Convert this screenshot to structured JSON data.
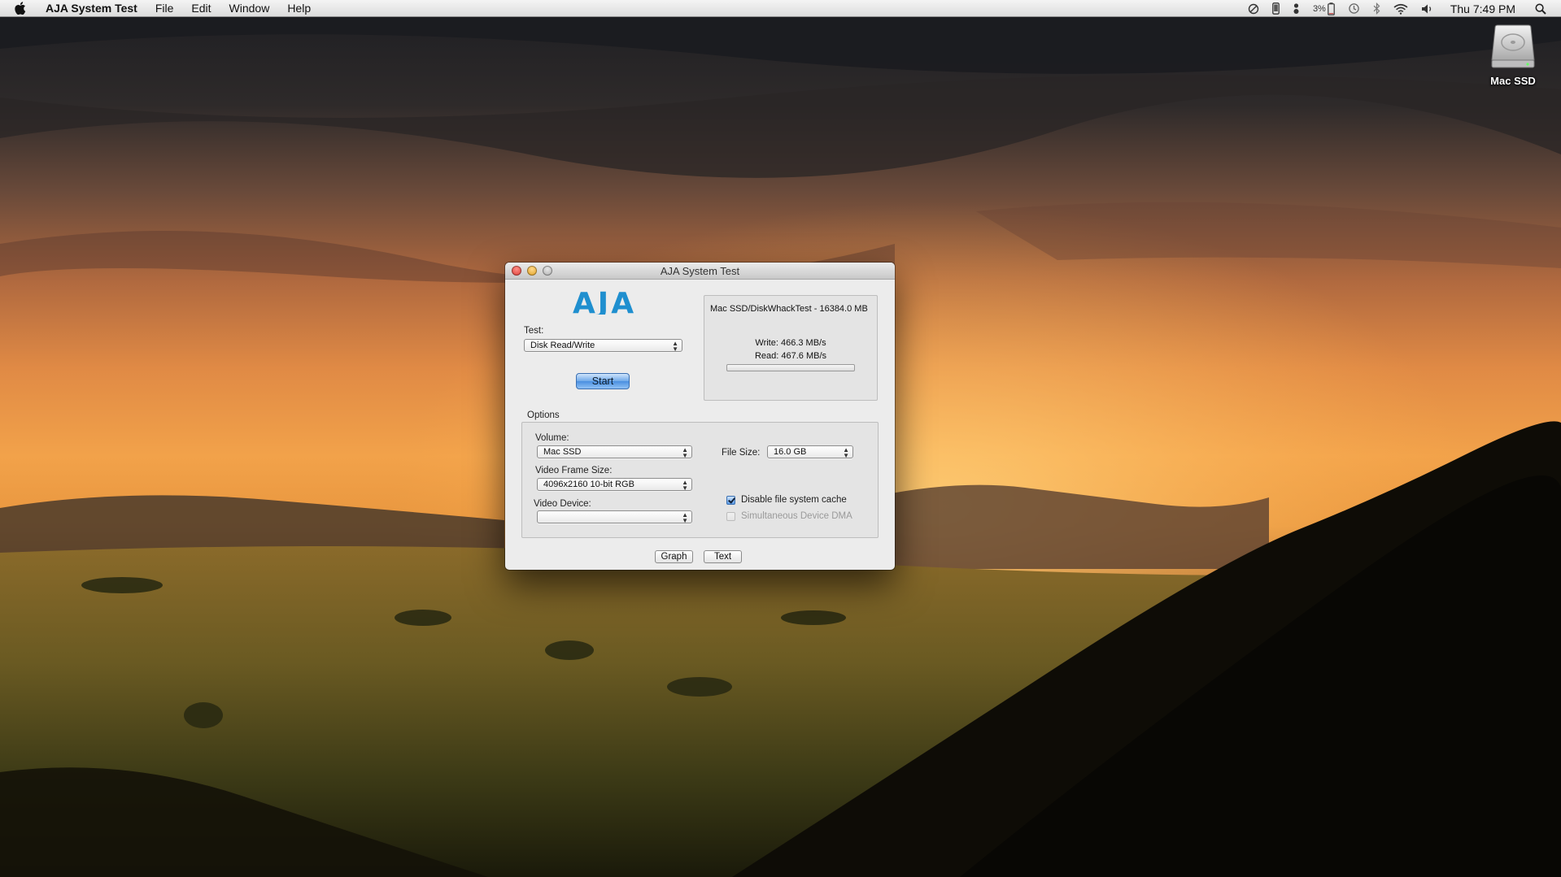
{
  "menubar": {
    "app_name": "AJA System Test",
    "menus": [
      "File",
      "Edit",
      "Window",
      "Help"
    ],
    "battery_percent": "3%",
    "clock": "Thu 7:49 PM"
  },
  "desktop": {
    "icons": [
      {
        "label": "Mac SSD",
        "icon": "hard-drive-icon"
      }
    ]
  },
  "window": {
    "title": "AJA System Test",
    "logo_text": "AJA",
    "test_label": "Test:",
    "test_value": "Disk Read/Write",
    "start_label": "Start",
    "results": {
      "path": "Mac SSD/DiskWhackTest - 16384.0 MB",
      "write": "Write: 466.3 MB/s",
      "read": "Read: 467.6 MB/s",
      "progress": 0
    },
    "options": {
      "section_label": "Options",
      "volume_label": "Volume:",
      "volume_value": "Mac SSD",
      "frame_size_label": "Video Frame Size:",
      "frame_size_value": "4096x2160 10-bit RGB",
      "device_label": "Video Device:",
      "device_value": "",
      "file_size_label": "File Size:",
      "file_size_value": "16.0 GB",
      "disable_cache_label": "Disable file system cache",
      "disable_cache_checked": true,
      "dma_label": "Simultaneous Device DMA",
      "dma_checked": false
    },
    "graph_label": "Graph",
    "text_label": "Text"
  },
  "colors": {
    "aja_blue": "#1f8fcf",
    "start_button": "#4a8fe0"
  }
}
